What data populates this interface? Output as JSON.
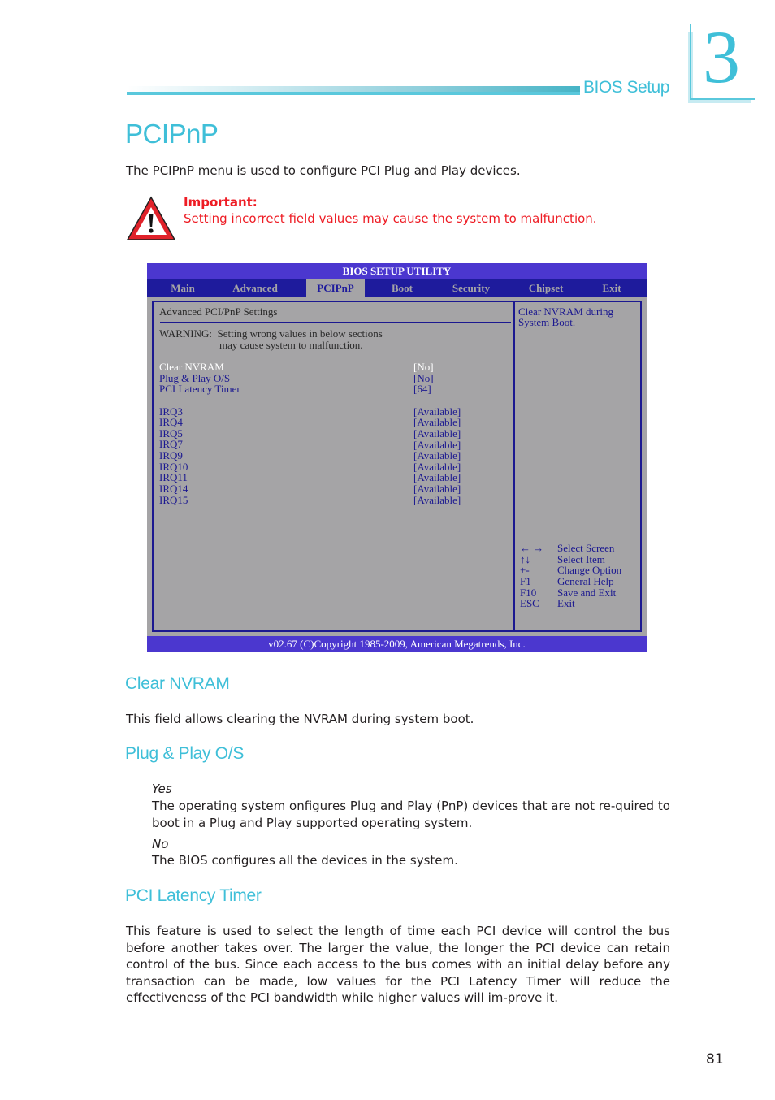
{
  "header": {
    "section_label": "BIOS Setup",
    "chapter_number": "3",
    "accent_color": "#3fbfd8"
  },
  "page": {
    "title": "PCIPnP",
    "intro": "The PCIPnP menu is used to configure PCI Plug and Play devices.",
    "important_label": "Important:",
    "important_text": "Setting incorrect field values may cause the system to malfunction.",
    "warning_icon": "warning-triangle-icon",
    "page_number": "81"
  },
  "bios": {
    "title": "BIOS SETUP UTILITY",
    "tabs": [
      {
        "label": "Main",
        "active": false
      },
      {
        "label": "Advanced",
        "active": false
      },
      {
        "label": "PCIPnP",
        "active": true
      },
      {
        "label": "Boot",
        "active": false
      },
      {
        "label": "Security",
        "active": false
      },
      {
        "label": "Chipset",
        "active": false
      },
      {
        "label": "Exit",
        "active": false
      }
    ],
    "section_heading": "Advanced PCI/PnP Settings",
    "warning_line1": "WARNING:  Setting wrong values in below sections",
    "warning_line2": "may cause system to malfunction.",
    "settings": [
      {
        "label": "Clear NVRAM",
        "value": "[No]",
        "selected": true
      },
      {
        "label": "Plug & Play O/S",
        "value": "[No]",
        "selected": false
      },
      {
        "label": "PCI Latency Timer",
        "value": "[64]",
        "selected": false
      }
    ],
    "irqs": [
      {
        "label": "IRQ3",
        "value": "[Available]"
      },
      {
        "label": "IRQ4",
        "value": "[Available]"
      },
      {
        "label": "IRQ5",
        "value": "[Available]"
      },
      {
        "label": "IRQ7",
        "value": "[Available]"
      },
      {
        "label": "IRQ9",
        "value": "[Available]"
      },
      {
        "label": "IRQ10",
        "value": "[Available]"
      },
      {
        "label": "IRQ11",
        "value": "[Available]"
      },
      {
        "label": "IRQ14",
        "value": "[Available]"
      },
      {
        "label": "IRQ15",
        "value": "[Available]"
      }
    ],
    "help_line1": "Clear NVRAM during",
    "help_line2": "System Boot.",
    "keys": [
      {
        "key": "← →",
        "action": "Select Screen"
      },
      {
        "key": "↑↓",
        "action": "Select Item"
      },
      {
        "key": "+-",
        "action": "Change Option"
      },
      {
        "key": "F1",
        "action": "General Help"
      },
      {
        "key": "F10",
        "action": "Save and Exit"
      },
      {
        "key": "ESC",
        "action": "Exit"
      }
    ],
    "footer": "v02.67 (C)Copyright 1985-2009, American Megatrends, Inc.",
    "colors": {
      "title_bar": "#4b37cf",
      "tab_bar": "#1e1b9c",
      "panel_bg": "#a5a4a6",
      "text_blue": "#1b1890"
    }
  },
  "sections": [
    {
      "heading": "Clear NVRAM",
      "body": "This field allows clearing the NVRAM during system boot."
    },
    {
      "heading": "Plug & Play O/S",
      "options": [
        {
          "name": "Yes",
          "desc": "The operating system onfigures Plug and Play (PnP) devices that are not re-quired to boot in a Plug and Play supported operating system."
        },
        {
          "name": "No",
          "desc": "The BIOS configures all the devices in the system."
        }
      ]
    },
    {
      "heading": "PCI Latency Timer",
      "body": "This feature is used to select the length of time each PCI device will control the bus before another takes over. The larger the value, the longer the PCI device can retain control of the bus. Since each access to the bus comes with an initial delay before any transaction can be made, low values for the PCI Latency Timer will reduce the effectiveness of the PCI bandwidth while higher values will im-prove it."
    }
  ]
}
